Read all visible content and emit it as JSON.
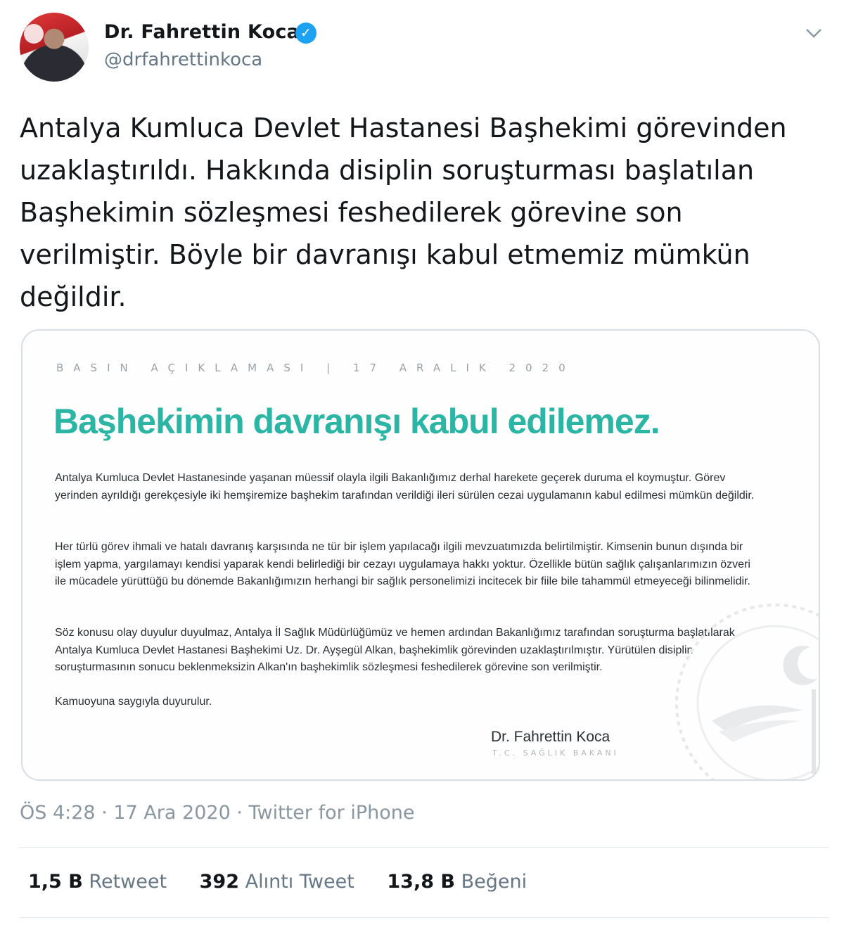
{
  "author": {
    "name": "Dr. Fahrettin Koca",
    "handle": "@drfahrettinkoca"
  },
  "tweet": {
    "text": "Antalya Kumluca Devlet Hastanesi Başhekimi görevinden uzaklaştırıldı. Hakkında disiplin soruşturması başlatılan Başhekimin sözleşmesi feshedilerek görevine son verilmiştir. Böyle bir davranışı kabul etmemiz mümkün değildir."
  },
  "press_release": {
    "header": "BASIN AÇIKLAMASI | 17 ARALIK 2020",
    "headline": "Başhekimin davranışı kabul edilemez.",
    "paragraphs": [
      "Antalya Kumluca Devlet Hastanesinde yaşanan müessif olayla ilgili Bakanlığımız derhal harekete geçerek duruma el koymuştur. Görev yerinden ayrıldığı gerekçesiyle iki hemşiremize başhekim tarafından verildiği ileri sürülen cezai uygulamanın kabul edilmesi mümkün değildir.",
      "Her türlü görev ihmali ve hatalı davranış karşısında ne tür bir işlem yapılacağı ilgili mevzuatımızda belirtilmiştir. Kimsenin bunun dışında bir işlem yapma, yargılamayı kendisi yaparak kendi belirlediği bir cezayı uygulamaya hakkı yoktur. Özellikle bütün sağlık çalışanlarımızın özveri ile mücadele yürüttüğü bu dönemde Bakanlığımızın herhangi bir sağlık personelimizi incitecek bir fiile bile tahammül etmeyeceği bilinmelidir.",
      "Söz konusu olay duyulur duyulmaz, Antalya İl Sağlık Müdürlüğümüz ve hemen ardından Bakanlığımız tarafından soruşturma başlatılarak Antalya Kumluca Devlet Hastanesi Başhekimi Uz. Dr. Ayşegül Alkan, başhekimlik görevinden uzaklaştırılmıştır. Yürütülen disiplin soruşturmasının sonucu beklenmeksizin Alkan'ın başhekimlik sözleşmesi feshedilerek görevine son verilmiştir.",
      "Kamuoyuna saygıyla duyurulur."
    ],
    "signature_name": "Dr. Fahrettin Koca",
    "signature_title": "T.C. SAĞLIK BAKANI"
  },
  "meta": {
    "time": "ÖS 4:28",
    "date": "17 Ara 2020",
    "source": "Twitter for iPhone",
    "separator": "·"
  },
  "stats": {
    "retweets_count": "1,5 B",
    "retweets_label": "Retweet",
    "quotes_count": "392",
    "quotes_label": "Alıntı Tweet",
    "likes_count": "13,8 B",
    "likes_label": "Beğeni"
  },
  "icons": {
    "verified": "verified-badge-icon",
    "menu": "chevron-down-icon"
  },
  "colors": {
    "verified_blue": "#1da1f2",
    "headline_teal": "#2bb5a5",
    "muted_text": "#657786"
  }
}
